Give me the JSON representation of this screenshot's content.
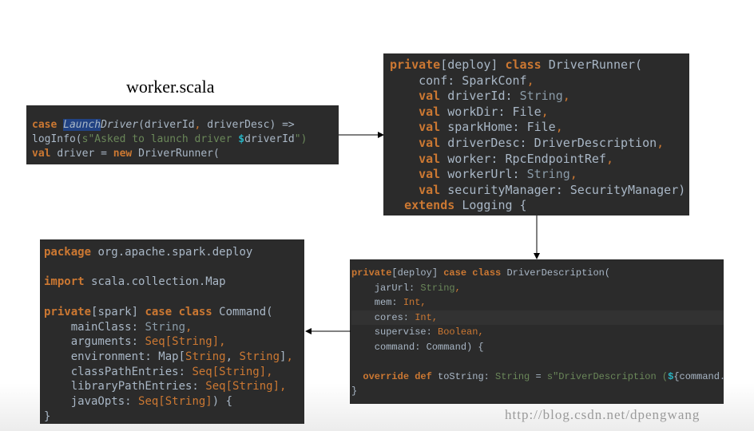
{
  "title": "worker.scala",
  "watermark": "http://blog.csdn.net/dpengwang",
  "colors": {
    "background": "#2b2b2b",
    "keyword": "#cc7832",
    "text": "#a9b7c6",
    "string": "#6a8759"
  },
  "snippets": {
    "worker": [
      [
        [
          "case ",
          "kw"
        ],
        [
          "Launch",
          "hl"
        ],
        [
          "Driver",
          "it"
        ],
        [
          "(driverId",
          ""
        ],
        [
          ", ",
          "ot"
        ],
        [
          "driverDesc) =>",
          ""
        ]
      ],
      [
        [
          "logInfo(",
          ""
        ],
        [
          "s\"Asked to launch driver ",
          "st"
        ],
        [
          "$",
          "dl"
        ],
        [
          "driverId",
          ""
        ],
        [
          "\")",
          "st"
        ]
      ],
      [
        [
          "val ",
          "kw"
        ],
        [
          "driver = ",
          ""
        ],
        [
          "new ",
          "kw"
        ],
        [
          "DriverRunner(",
          ""
        ]
      ]
    ],
    "driver_runner": [
      [
        [
          "private",
          "kw"
        ],
        [
          "[deploy] ",
          ""
        ],
        [
          "class ",
          "kw"
        ],
        [
          "DriverRunner(",
          ""
        ]
      ],
      [
        [
          "    conf: SparkConf",
          ""
        ],
        [
          ",",
          "ot"
        ]
      ],
      [
        [
          "    ",
          ""
        ],
        [
          "val ",
          "kw"
        ],
        [
          "driverId: ",
          ""
        ],
        [
          "String",
          "ty"
        ],
        [
          ",",
          "ot"
        ]
      ],
      [
        [
          "    ",
          ""
        ],
        [
          "val ",
          "kw"
        ],
        [
          "workDir: File",
          ""
        ],
        [
          ",",
          "ot"
        ]
      ],
      [
        [
          "    ",
          ""
        ],
        [
          "val ",
          "kw"
        ],
        [
          "sparkHome: File",
          ""
        ],
        [
          ",",
          "ot"
        ]
      ],
      [
        [
          "    ",
          ""
        ],
        [
          "val ",
          "kw"
        ],
        [
          "driverDesc: DriverDescription",
          ""
        ],
        [
          ",",
          "ot"
        ]
      ],
      [
        [
          "    ",
          ""
        ],
        [
          "val ",
          "kw"
        ],
        [
          "worker: RpcEndpointRef",
          ""
        ],
        [
          ",",
          "ot"
        ]
      ],
      [
        [
          "    ",
          ""
        ],
        [
          "val ",
          "kw"
        ],
        [
          "workerUrl: ",
          ""
        ],
        [
          "String",
          "ty"
        ],
        [
          ",",
          "ot"
        ]
      ],
      [
        [
          "    ",
          ""
        ],
        [
          "val ",
          "kw"
        ],
        [
          "securityManager: SecurityManager)",
          ""
        ]
      ],
      [
        [
          "  ",
          ""
        ],
        [
          "extends ",
          "kw"
        ],
        [
          "Logging {",
          ""
        ]
      ]
    ],
    "command": [
      [
        [
          "package ",
          "kw"
        ],
        [
          "org.apache.spark.deploy",
          ""
        ]
      ],
      [
        [
          "",
          ""
        ]
      ],
      [
        [
          "import ",
          "kw"
        ],
        [
          "scala.collection.Map",
          ""
        ]
      ],
      [
        [
          "",
          ""
        ]
      ],
      [
        [
          "private",
          "kw"
        ],
        [
          "[spark] ",
          ""
        ],
        [
          "case class ",
          "kw"
        ],
        [
          "Command(",
          ""
        ]
      ],
      [
        [
          "    mainClass: ",
          ""
        ],
        [
          "String",
          "ty"
        ],
        [
          ",",
          "ot"
        ]
      ],
      [
        [
          "    arguments: ",
          ""
        ],
        [
          "Seq[String]",
          "ot"
        ],
        [
          ",",
          "ot"
        ]
      ],
      [
        [
          "    environment: Map[",
          ""
        ],
        [
          "String",
          "ot"
        ],
        [
          ", ",
          ""
        ],
        [
          "String",
          "ot"
        ],
        [
          "]",
          ""
        ],
        [
          ",",
          "ot"
        ]
      ],
      [
        [
          "    classPathEntries: ",
          ""
        ],
        [
          "Seq[String]",
          "ot"
        ],
        [
          ",",
          "ot"
        ]
      ],
      [
        [
          "    libraryPathEntries: ",
          ""
        ],
        [
          "Seq[String]",
          "ot"
        ],
        [
          ",",
          "ot"
        ]
      ],
      [
        [
          "    javaOpts: ",
          ""
        ],
        [
          "Seq[String]",
          "ot"
        ],
        [
          ") {",
          ""
        ]
      ],
      [
        [
          "}",
          ""
        ]
      ]
    ],
    "driver_description": [
      [
        [
          "private",
          "kw"
        ],
        [
          "[deploy] ",
          ""
        ],
        [
          "case class ",
          "kw"
        ],
        [
          "DriverDescription(",
          ""
        ]
      ],
      [
        [
          "    jarUrl: ",
          ""
        ],
        [
          "String",
          "st"
        ],
        [
          ",",
          "ot"
        ]
      ],
      [
        [
          "    mem: ",
          ""
        ],
        [
          "Int",
          "ot"
        ],
        [
          ",",
          "ot"
        ]
      ],
      [
        [
          "    cores: ",
          ""
        ],
        [
          "Int",
          "ot"
        ],
        [
          ",",
          "ot"
        ]
      ],
      [
        [
          "    supervise: ",
          ""
        ],
        [
          "Boolean",
          "ot"
        ],
        [
          ",",
          "ot"
        ]
      ],
      [
        [
          "    command: Command) {",
          ""
        ]
      ],
      [
        [
          "",
          ""
        ]
      ],
      [
        [
          "  ",
          ""
        ],
        [
          "override def ",
          "kw"
        ],
        [
          "toString",
          ""
        ],
        [
          ": ",
          ""
        ],
        [
          "String",
          "st"
        ],
        [
          " = ",
          ""
        ],
        [
          "s\"DriverDescription (",
          "st"
        ],
        [
          "$",
          "dl"
        ],
        [
          "{command.mainClass}",
          ""
        ],
        [
          ")\"",
          "st"
        ]
      ],
      [
        [
          "}",
          ""
        ]
      ]
    ]
  }
}
